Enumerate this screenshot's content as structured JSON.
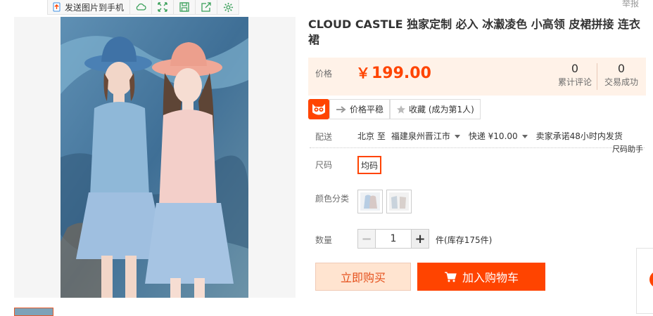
{
  "toolbar": {
    "send_label": "发送图片到手机",
    "icons": [
      "phone-upload-icon",
      "cloud-icon",
      "expand-icon",
      "save-icon",
      "share-icon",
      "gear-icon"
    ]
  },
  "report_label": "举报",
  "product": {
    "title": "CLOUD CASTLE 独家定制 必入 冰瀫凌色 小高领 皮裙拼接 连衣裙"
  },
  "price": {
    "label": "价格",
    "currency": "￥",
    "value": "199.00",
    "reviews_count": "0",
    "reviews_label": "累计评论",
    "deals_count": "0",
    "deals_label": "交易成功"
  },
  "actions": {
    "compare_label": "价格平稳",
    "favorite_label": "收藏 (成为第1人)"
  },
  "delivery": {
    "label": "配送",
    "from": "北京 至",
    "to": "福建泉州晋江市",
    "shipping": "快递 ¥10.00",
    "promise": "卖家承诺48小时内发货"
  },
  "size": {
    "label": "尺码",
    "helper": "尺码助手",
    "option": "均码"
  },
  "color": {
    "label": "颜色分类"
  },
  "quantity": {
    "label": "数量",
    "value": "1",
    "unit": "件",
    "stock": "(库存175件)"
  },
  "buttons": {
    "buy_now": "立即购买",
    "add_to_cart": "加入购物车"
  },
  "colors": {
    "accent": "#ff4400",
    "price_bg": "#fff2e8"
  }
}
